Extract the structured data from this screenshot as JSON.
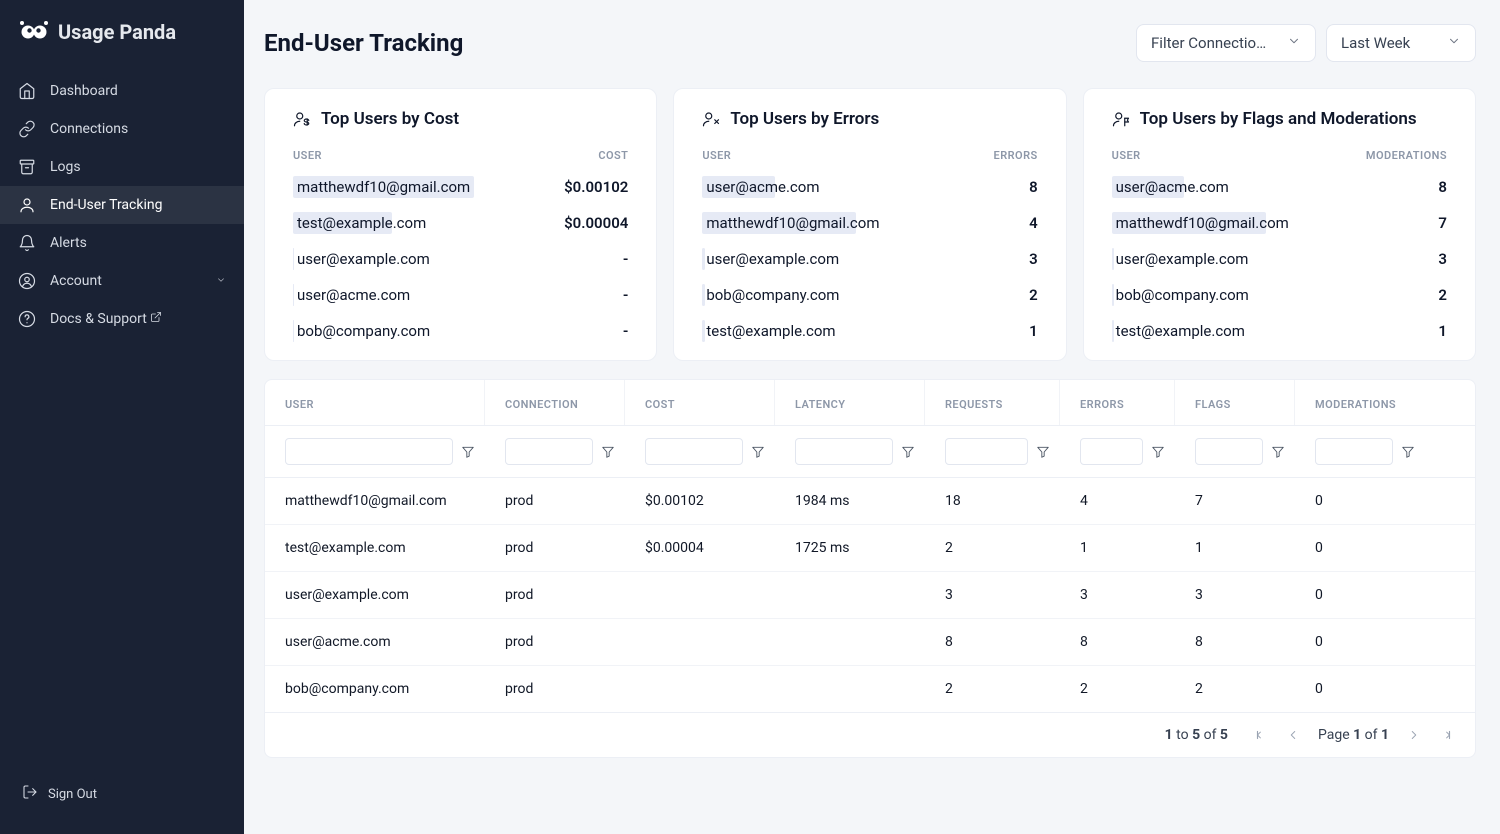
{
  "brand": {
    "name": "Usage Panda"
  },
  "nav": {
    "items": [
      {
        "label": "Dashboard",
        "icon": "home-icon"
      },
      {
        "label": "Connections",
        "icon": "link-icon"
      },
      {
        "label": "Logs",
        "icon": "archive-icon"
      },
      {
        "label": "End-User Tracking",
        "icon": "user-icon",
        "active": true
      },
      {
        "label": "Alerts",
        "icon": "bell-icon"
      },
      {
        "label": "Account",
        "icon": "user-circle-icon",
        "expandable": true
      },
      {
        "label": "Docs & Support",
        "icon": "help-icon",
        "external": true
      }
    ],
    "signout": "Sign Out"
  },
  "page": {
    "title": "End-User Tracking"
  },
  "filters": {
    "connection": "Filter Connection...",
    "range": "Last Week"
  },
  "cards": [
    {
      "title": "Top Users by Cost",
      "col_user": "USER",
      "col_val": "COST",
      "rows": [
        {
          "name": "matthewdf10@gmail.com",
          "val": "$0.00102",
          "barPct": 100
        },
        {
          "name": "test@example.com",
          "val": "$0.00004",
          "barPct": 72
        },
        {
          "name": "user@example.com",
          "val": "-",
          "barPct": 1
        },
        {
          "name": "user@acme.com",
          "val": "-",
          "barPct": 1
        },
        {
          "name": "bob@company.com",
          "val": "-",
          "barPct": 1
        }
      ]
    },
    {
      "title": "Top Users by Errors",
      "col_user": "USER",
      "col_val": "ERRORS",
      "rows": [
        {
          "name": "user@acme.com",
          "val": "8",
          "barPct": 60
        },
        {
          "name": "matthewdf10@gmail.com",
          "val": "4",
          "barPct": 85
        },
        {
          "name": "user@example.com",
          "val": "3",
          "barPct": 2
        },
        {
          "name": "bob@company.com",
          "val": "2",
          "barPct": 2
        },
        {
          "name": "test@example.com",
          "val": "1",
          "barPct": 2
        }
      ]
    },
    {
      "title": "Top Users by Flags and Moderations",
      "col_user": "USER",
      "col_val": "MODERATIONS",
      "rows": [
        {
          "name": "user@acme.com",
          "val": "8",
          "barPct": 60
        },
        {
          "name": "matthewdf10@gmail.com",
          "val": "7",
          "barPct": 85
        },
        {
          "name": "user@example.com",
          "val": "3",
          "barPct": 2
        },
        {
          "name": "bob@company.com",
          "val": "2",
          "barPct": 2
        },
        {
          "name": "test@example.com",
          "val": "1",
          "barPct": 2
        }
      ]
    }
  ],
  "table": {
    "columns": [
      "USER",
      "CONNECTION",
      "COST",
      "LATENCY",
      "REQUESTS",
      "ERRORS",
      "FLAGS",
      "MODERATIONS"
    ],
    "rows": [
      {
        "user": "matthewdf10@gmail.com",
        "connection": "prod",
        "cost": "$0.00102",
        "latency": "1984 ms",
        "requests": "18",
        "errors": "4",
        "flags": "7",
        "moderations": "0"
      },
      {
        "user": "test@example.com",
        "connection": "prod",
        "cost": "$0.00004",
        "latency": "1725 ms",
        "requests": "2",
        "errors": "1",
        "flags": "1",
        "moderations": "0"
      },
      {
        "user": "user@example.com",
        "connection": "prod",
        "cost": "",
        "latency": "",
        "requests": "3",
        "errors": "3",
        "flags": "3",
        "moderations": "0"
      },
      {
        "user": "user@acme.com",
        "connection": "prod",
        "cost": "",
        "latency": "",
        "requests": "8",
        "errors": "8",
        "flags": "8",
        "moderations": "0"
      },
      {
        "user": "bob@company.com",
        "connection": "prod",
        "cost": "",
        "latency": "",
        "requests": "2",
        "errors": "2",
        "flags": "2",
        "moderations": "0"
      }
    ]
  },
  "pagination": {
    "from": "1",
    "to": "5",
    "of": "5",
    "page": "1",
    "pages": "1",
    "to_label": " to ",
    "of_label": " of ",
    "page_label": "Page "
  }
}
